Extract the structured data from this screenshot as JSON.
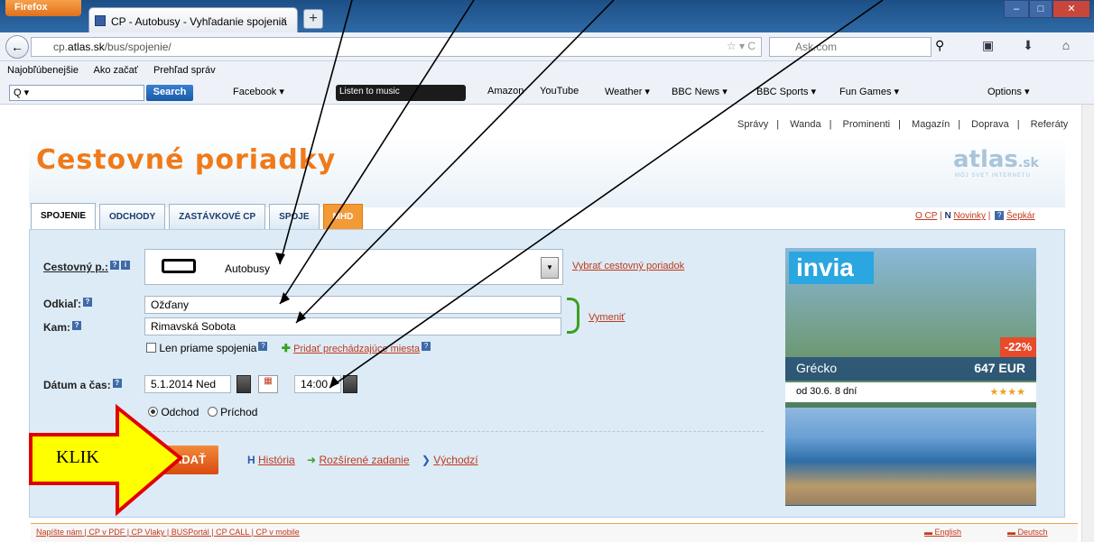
{
  "browser": {
    "menu_label": "Firefox",
    "tab_title": "CP - Autobusy - Vyhľadanie spojenia",
    "url_prefix": "cp.",
    "url_domain": "atlas.sk",
    "url_path": "/bus/spojenie/",
    "search_placeholder": "Ask.com",
    "bookmarks": [
      "Najobľúbenejšie",
      "Ako začať",
      "Prehľad správ"
    ],
    "toolbar": {
      "search_btn": "Search",
      "items": [
        "Facebook ▾",
        "Listen to music",
        "Amazon",
        "YouTube",
        "Weather ▾",
        "BBC News ▾",
        "BBC Sports ▾",
        "Fun Games ▾"
      ],
      "options": "Options ▾"
    }
  },
  "site": {
    "top_nav": [
      "Správy",
      "Wanda",
      "Prominenti",
      "Magazín",
      "Doprava",
      "Referáty"
    ],
    "title": "Cestovné poriadky",
    "logo": "atlas",
    "logo_suffix": ".sk",
    "logo_sub": "MÔJ SVET INTERNETU",
    "tabs": [
      "SPOJENIE",
      "ODCHODY",
      "ZASTÁVKOVÉ CP",
      "SPOJE",
      "MHD"
    ],
    "right_links": [
      "O CP",
      "Novinky",
      "Šepkár"
    ]
  },
  "form": {
    "cp_label": "Cestovný p.:",
    "cp_value": "Autobusy",
    "cp_link": "Vybrať cestovný poriadok",
    "from_label": "Odkiaľ:",
    "from_value": "Ožďany",
    "to_label": "Kam:",
    "to_value": "Rimavská Sobota",
    "swap_link": "Vymeniť",
    "direct_label": "Len priame spojenia",
    "add_stops": "Pridať prechádzajúce miesta",
    "datetime_label": "Dátum a čas:",
    "date_value": "5.1.2014 Ned",
    "time_value": "14:00",
    "radio_odchod": "Odchod",
    "radio_prichod": "Príchod",
    "submit": "ZADAŤ",
    "history": "História",
    "advanced": "Rozšírené zadanie",
    "default": "Východzí"
  },
  "ad": {
    "brand": "invia",
    "discount": "-22%",
    "destination": "Grécko",
    "price": "647 EUR",
    "period": "od 30.6. 8 dní",
    "stars": "★★★★"
  },
  "footer": {
    "links": "Napíšte nám | CP v PDF | CP Vlaky | BUSPortál | CP CALL | CP v mobile",
    "lang1": "English",
    "lang2": "Deutsch"
  },
  "annotation": {
    "klik": "KLIK"
  },
  "colors": {
    "accent": "#ef7a1a",
    "link": "#c0391b",
    "panel": "#dcebf6",
    "arrow_fill": "#ffff00",
    "arrow_border": "#e00000"
  }
}
